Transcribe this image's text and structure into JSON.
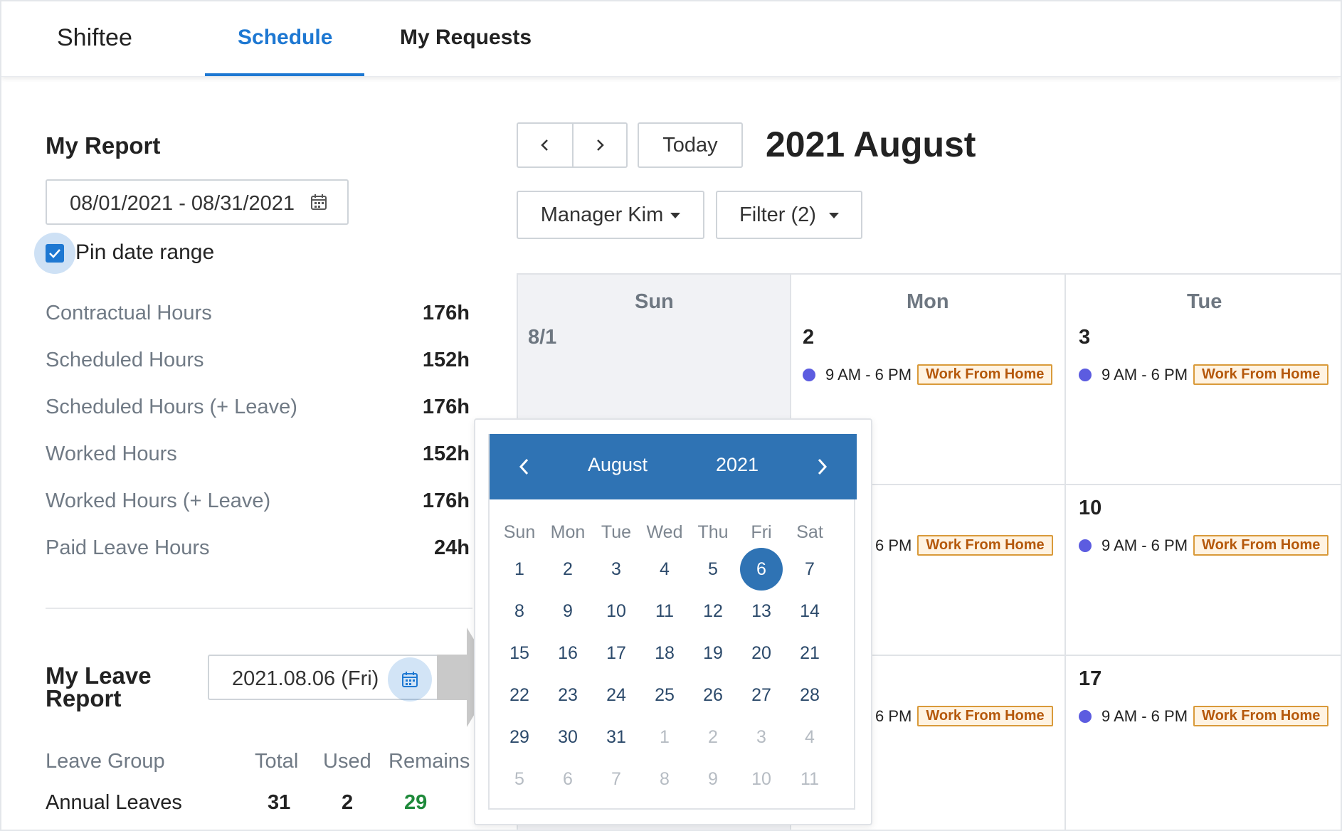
{
  "nav": {
    "brand": "Shiftee",
    "tabs": [
      {
        "label": "Schedule",
        "active": true
      },
      {
        "label": "My Requests",
        "active": false
      }
    ]
  },
  "report": {
    "title": "My Report",
    "date_range": "08/01/2021 - 08/31/2021",
    "pin_label": "Pin date range",
    "pin_checked": true,
    "stats": [
      {
        "label": "Contractual Hours",
        "value": "176h"
      },
      {
        "label": "Scheduled Hours",
        "value": "152h"
      },
      {
        "label": "Scheduled Hours (+ Leave)",
        "value": "176h"
      },
      {
        "label": "Worked Hours",
        "value": "152h"
      },
      {
        "label": "Worked Hours (+ Leave)",
        "value": "176h"
      },
      {
        "label": "Paid Leave Hours",
        "value": "24h"
      }
    ]
  },
  "leave": {
    "title_line1": "My Leave",
    "title_line2": "Report",
    "date": "2021.08.06 (Fri)",
    "headers": [
      "Leave Group",
      "Total",
      "Used",
      "Remains"
    ],
    "rows": [
      {
        "group": "Annual Leaves",
        "total": "31",
        "used": "2",
        "remains": "29"
      }
    ]
  },
  "toolbar": {
    "prev": "‹",
    "next": "›",
    "today": "Today",
    "month_title": "2021 August",
    "manager": "Manager Kim",
    "filter": "Filter (2)"
  },
  "calendar": {
    "weekdays": [
      "Sun",
      "Mon",
      "Tue"
    ],
    "first_row": [
      "8/1",
      "2",
      "3"
    ],
    "second_row_tue": "10",
    "third_row_tue": "17",
    "shift_time": "9 AM - 6 PM",
    "shift_time_partial": "6 PM",
    "shift_tag": "Work From Home"
  },
  "datepicker": {
    "month": "August",
    "year": "2021",
    "weekdays": [
      "Sun",
      "Mon",
      "Tue",
      "Wed",
      "Thu",
      "Fri",
      "Sat"
    ],
    "selected": "6",
    "weeks": [
      [
        "1",
        "2",
        "3",
        "4",
        "5",
        "6",
        "7"
      ],
      [
        "8",
        "9",
        "10",
        "11",
        "12",
        "13",
        "14"
      ],
      [
        "15",
        "16",
        "17",
        "18",
        "19",
        "20",
        "21"
      ],
      [
        "22",
        "23",
        "24",
        "25",
        "26",
        "27",
        "28"
      ],
      [
        "29",
        "30",
        "31",
        "1",
        "2",
        "3",
        "4"
      ],
      [
        "5",
        "6",
        "7",
        "8",
        "9",
        "10",
        "11"
      ]
    ]
  },
  "colors": {
    "accent": "#1e78d2",
    "picker_header": "#2f73b4",
    "shift_dot": "#5c5ce0",
    "tag_border": "#d99a3a",
    "remains_green": "#1f8a3b"
  }
}
